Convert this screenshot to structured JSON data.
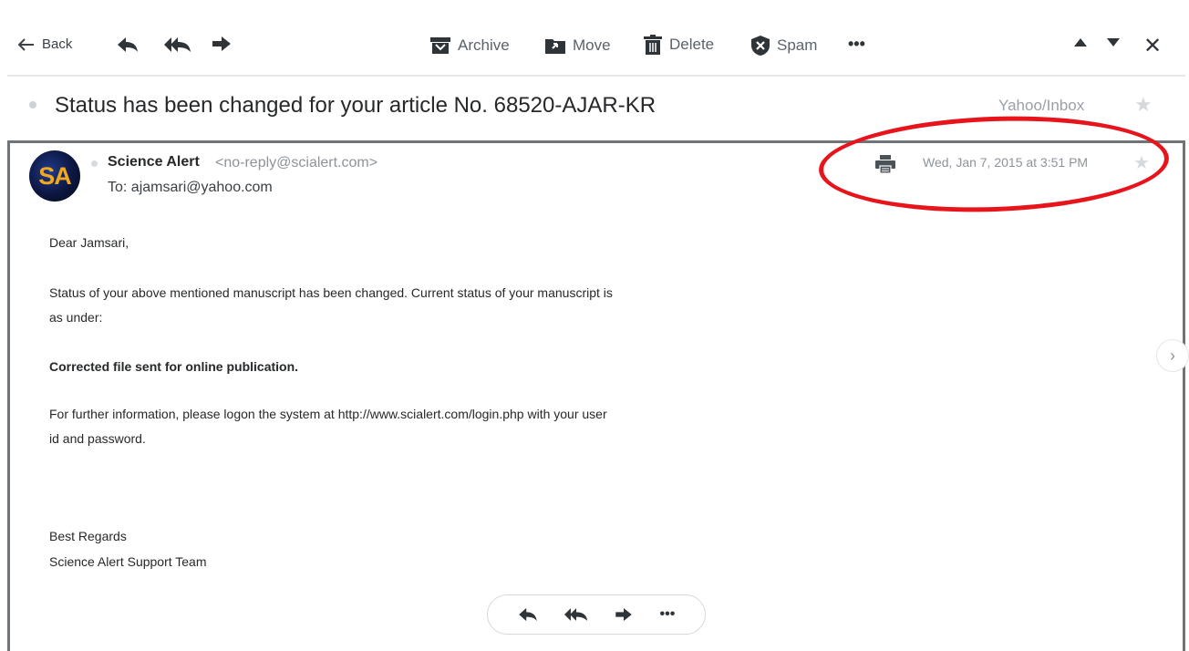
{
  "toolbar": {
    "back_label": "Back",
    "archive_label": "Archive",
    "move_label": "Move",
    "delete_label": "Delete",
    "spam_label": "Spam",
    "more_label": "•••",
    "close_label": "✕"
  },
  "message": {
    "subject": "Status has been changed for your article No. 68520-AJAR-KR",
    "folder": "Yahoo/Inbox",
    "sender_initials": "SA",
    "sender_name": "Science Alert",
    "sender_email": "<no-reply@scialert.com>",
    "to_line": "To: ajamsari@yahoo.com",
    "date": "Wed, Jan 7, 2015 at 3:51 PM",
    "body": {
      "greeting": "Dear Jamsari,",
      "para1_line1": "Status of your above mentioned manuscript has been changed. Current status of your manuscript is",
      "para1_line2": "as under:",
      "status": "Corrected file sent for online publication.",
      "para2_line1": "For further information, please logon the system at http://www.scialert.com/login.php with your user",
      "para2_line2": "id and password.",
      "closing1": "Best Regards",
      "closing2": "Science Alert Support Team"
    }
  },
  "bottom_actions": {
    "more_label": "•••"
  },
  "colors": {
    "annotation": "#e8141c",
    "icon": "#3b4045",
    "muted": "#8d949a"
  }
}
